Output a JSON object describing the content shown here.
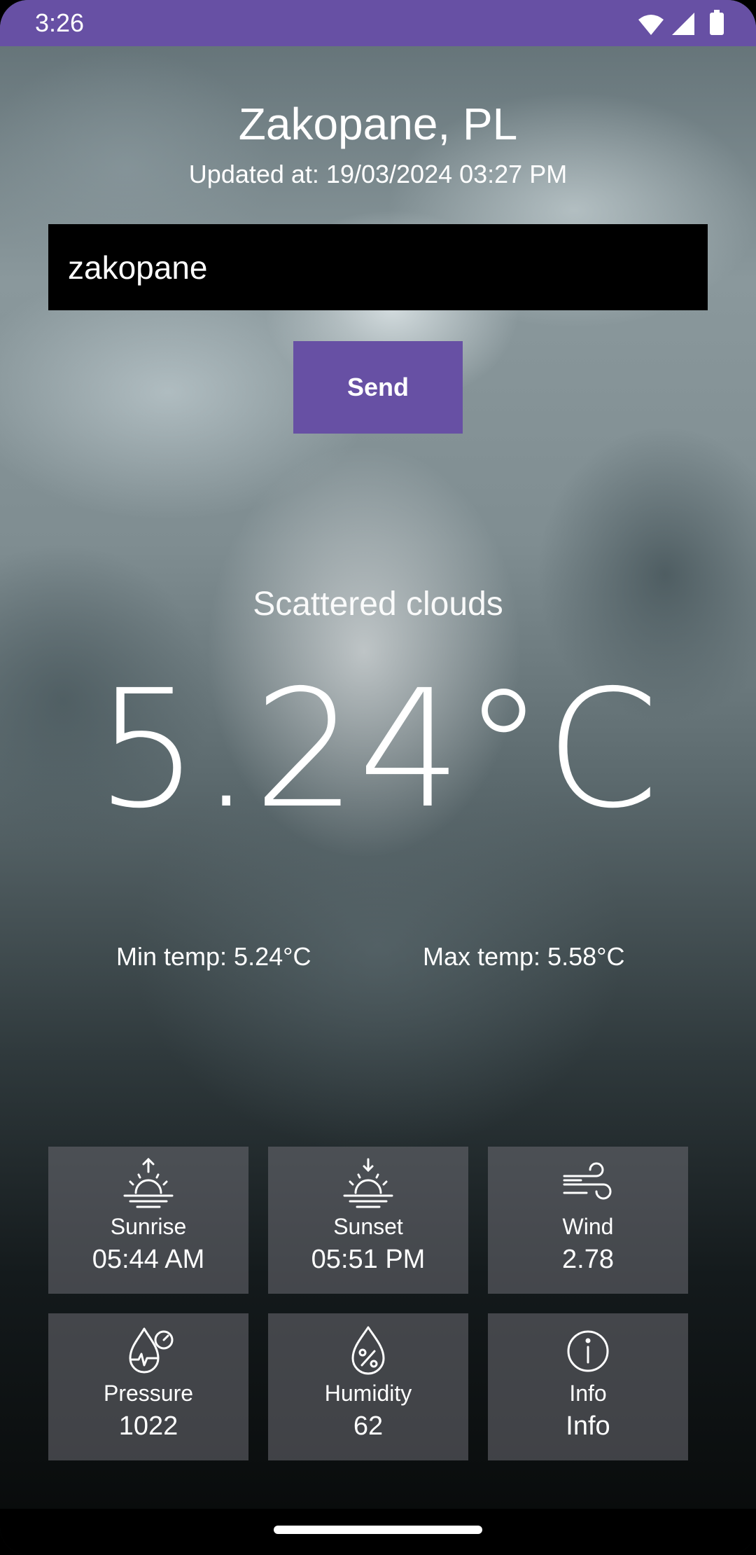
{
  "status_bar": {
    "time": "3:26",
    "icons": [
      "wifi-icon",
      "signal-icon",
      "battery-icon"
    ]
  },
  "header": {
    "city": "Zakopane, PL",
    "updated": "Updated at: 19/03/2024 03:27 PM"
  },
  "search": {
    "value": "zakopane",
    "button_label": "Send"
  },
  "weather": {
    "description": "Scattered clouds",
    "temperature": "5.24°C",
    "min_temp": "Min temp: 5.24°C",
    "max_temp": "Max temp: 5.58°C"
  },
  "tiles": [
    {
      "label": "Sunrise",
      "value": "05:44 AM",
      "icon": "sunrise-icon"
    },
    {
      "label": "Sunset",
      "value": "05:51 PM",
      "icon": "sunset-icon"
    },
    {
      "label": "Wind",
      "value": "2.78",
      "icon": "wind-icon"
    },
    {
      "label": "Pressure",
      "value": "1022",
      "icon": "pressure-icon"
    },
    {
      "label": "Humidity",
      "value": "62",
      "icon": "humidity-icon"
    },
    {
      "label": "Info",
      "value": "Info",
      "icon": "info-icon"
    }
  ],
  "colors": {
    "accent": "#6750a4",
    "search_bg": "#000000",
    "text": "#ffffff"
  }
}
